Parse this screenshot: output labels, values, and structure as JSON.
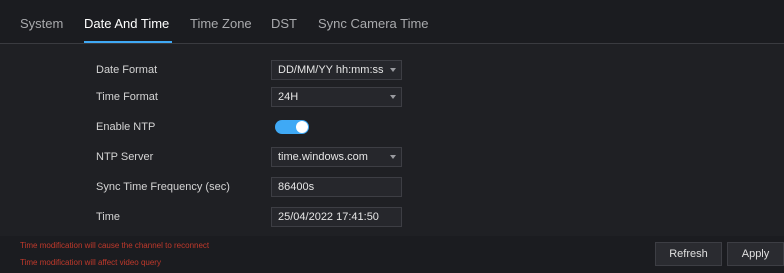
{
  "tabs": [
    {
      "label": "System",
      "active": false
    },
    {
      "label": "Date And Time",
      "active": true
    },
    {
      "label": "Time Zone",
      "active": false
    },
    {
      "label": "DST",
      "active": false
    },
    {
      "label": "Sync Camera Time",
      "active": false
    }
  ],
  "form": {
    "date_format": {
      "label": "Date Format",
      "value": "DD/MM/YY hh:mm:ss"
    },
    "time_format": {
      "label": "Time Format",
      "value": "24H"
    },
    "enable_ntp": {
      "label": "Enable NTP",
      "enabled": true
    },
    "ntp_server": {
      "label": "NTP Server",
      "value": "time.windows.com"
    },
    "sync_frequency": {
      "label": "Sync Time Frequency (sec)",
      "value": "86400s"
    },
    "time": {
      "label": "Time",
      "value": "25/04/2022 17:41:50"
    }
  },
  "warnings": [
    "Time modification will cause the channel to reconnect",
    "Time modification will affect video query"
  ],
  "buttons": {
    "refresh": "Refresh",
    "apply": "Apply"
  },
  "colors": {
    "accent": "#3fa9f5",
    "warning": "#c0392b",
    "background": "#1b1c20"
  }
}
